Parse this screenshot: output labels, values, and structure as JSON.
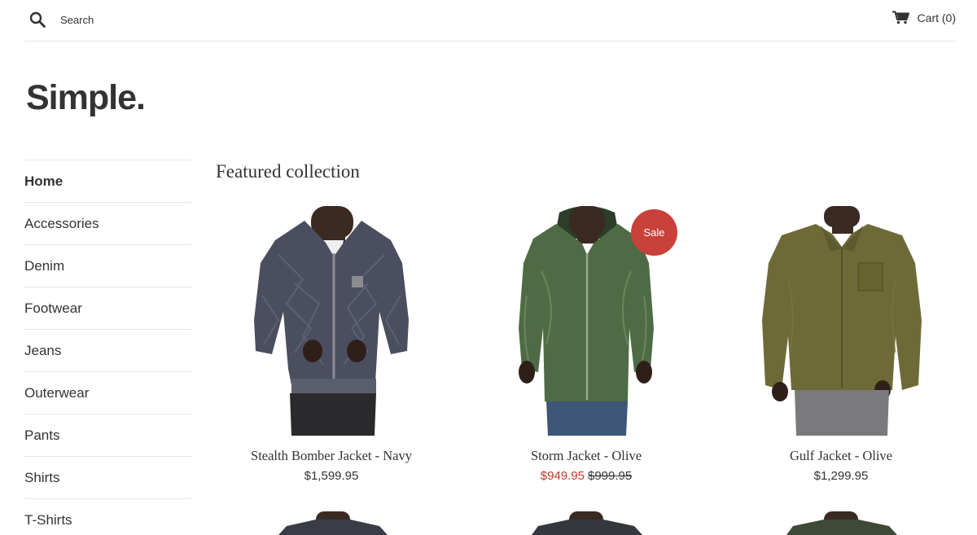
{
  "header": {
    "search_placeholder": "Search",
    "cart_label": "Cart (0)"
  },
  "logo": "Simple.",
  "sidebar": {
    "items": [
      {
        "label": "Home",
        "active": true
      },
      {
        "label": "Accessories"
      },
      {
        "label": "Denim"
      },
      {
        "label": "Footwear"
      },
      {
        "label": "Jeans"
      },
      {
        "label": "Outerwear"
      },
      {
        "label": "Pants"
      },
      {
        "label": "Shirts"
      },
      {
        "label": "T-Shirts"
      }
    ]
  },
  "main": {
    "title": "Featured collection",
    "products": [
      {
        "name": "Stealth Bomber Jacket - Navy",
        "price": "$1,599.95",
        "image": "navy-bomber-jacket",
        "color": "#4a4e5e"
      },
      {
        "name": "Storm Jacket - Olive",
        "sale_price": "$949.95",
        "compare_price": "$999.95",
        "badge": "Sale",
        "image": "olive-hooded-jacket",
        "color": "#4f6b45"
      },
      {
        "name": "Gulf Jacket - Olive",
        "price": "$1,299.95",
        "image": "olive-shirt-jacket",
        "color": "#6e6a38"
      }
    ]
  },
  "colors": {
    "sale": "#c0392b",
    "badge": "#c8413b",
    "divider": "#e6e6e6",
    "text": "#333333"
  }
}
